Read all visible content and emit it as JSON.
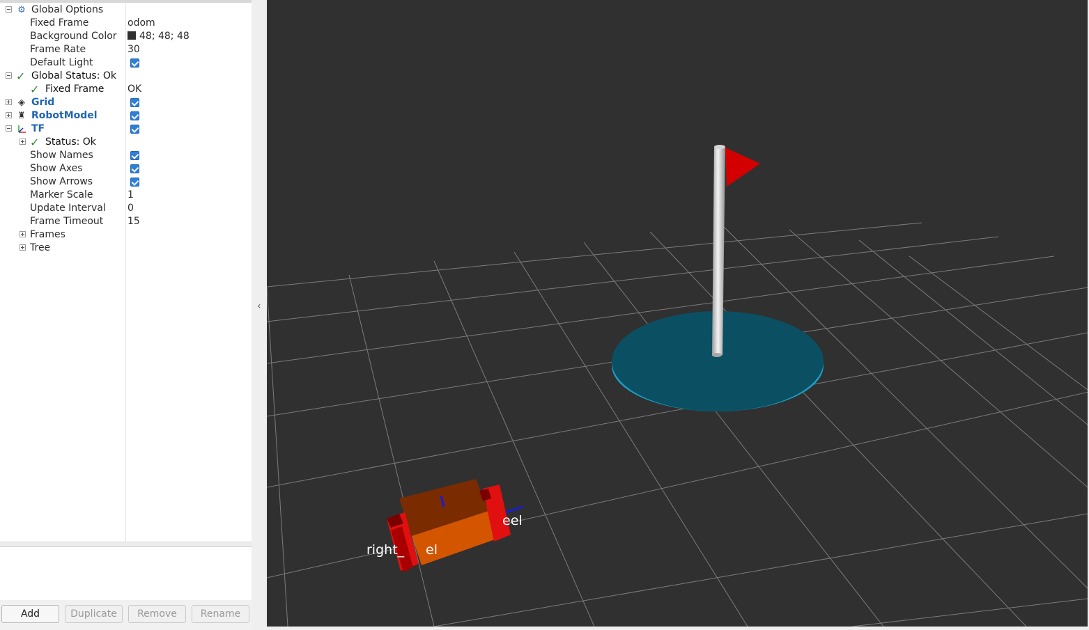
{
  "tree": {
    "global_options": "Global Options",
    "fixed_frame_label": "Fixed Frame",
    "fixed_frame_value": "odom",
    "background_color_label": "Background Color",
    "background_color_value": "48; 48; 48",
    "frame_rate_label": "Frame Rate",
    "frame_rate_value": "30",
    "default_light_label": "Default Light",
    "global_status": "Global Status: Ok",
    "status_fixed_frame_label": "Fixed Frame",
    "status_fixed_frame_value": "OK",
    "grid": "Grid",
    "robot_model": "RobotModel",
    "tf": "TF",
    "tf_status": "Status: Ok",
    "show_names": "Show Names",
    "show_axes": "Show Axes",
    "show_arrows": "Show Arrows",
    "marker_scale_label": "Marker Scale",
    "marker_scale_value": "1",
    "update_interval_label": "Update Interval",
    "update_interval_value": "0",
    "frame_timeout_label": "Frame Timeout",
    "frame_timeout_value": "15",
    "frames": "Frames",
    "tree_item": "Tree"
  },
  "buttons": {
    "add": "Add",
    "duplicate": "Duplicate",
    "remove": "Remove",
    "rename": "Rename"
  },
  "viewport": {
    "label_left": "right_",
    "label_left_tail": "el",
    "label_right": "eel"
  },
  "icons": {
    "global_options": "gear-icon",
    "grid": "grid-icon",
    "robot_model": "robot-icon",
    "tf": "axes-icon",
    "collapse": "chevron-left-icon"
  },
  "colors": {
    "viewport_bg": "#303030",
    "accent_blue": "#2f7fd6",
    "ok_green": "#2f8a2f",
    "goal_disc": "#0b4f63",
    "flag_red": "#d40000",
    "robot_body": "#d45500",
    "robot_wheels": "#e01010"
  }
}
